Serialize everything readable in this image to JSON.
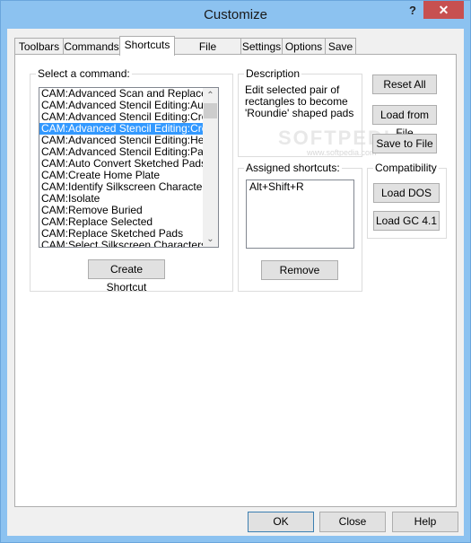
{
  "window": {
    "title": "Customize",
    "help_label": "?",
    "close_label": "✕"
  },
  "tabs": [
    {
      "label": "Toolbars",
      "active": false
    },
    {
      "label": "Commands",
      "active": false
    },
    {
      "label": "Shortcuts",
      "active": true
    },
    {
      "label": "File Locations",
      "active": false
    },
    {
      "label": "Settings",
      "active": false
    },
    {
      "label": "Options",
      "active": false
    },
    {
      "label": "Save",
      "active": false
    }
  ],
  "commands": {
    "legend": "Select a command:",
    "items": [
      "CAM:Advanced Scan and Replace",
      "CAM:Advanced Stencil Editing:Auto F",
      "CAM:Advanced Stencil Editing:Create",
      "CAM:Advanced Stencil Editing:Create",
      "CAM:Advanced Stencil Editing:Heel a",
      "CAM:Advanced Stencil Editing:Pad S",
      "CAM:Auto Convert Sketched Pads",
      "CAM:Create Home Plate",
      "CAM:Identify Silkscreen Characters",
      "CAM:Isolate",
      "CAM:Remove Buried",
      "CAM:Replace Selected",
      "CAM:Replace Sketched Pads",
      "CAM:Select Silkscreen Characters"
    ],
    "selected_index": 3,
    "create_shortcut_label": "Create Shortcut"
  },
  "description": {
    "legend": "Description",
    "text_lines": [
      "Edit selected pair of",
      "rectangles to become",
      "'Roundie' shaped pads"
    ]
  },
  "assigned": {
    "legend": "Assigned shortcuts:",
    "items": [
      "Alt+Shift+R"
    ],
    "remove_label": "Remove"
  },
  "actions": {
    "reset_all": "Reset All",
    "load_from_file": "Load from File",
    "save_to_file": "Save to File"
  },
  "compatibility": {
    "legend": "Compatibility",
    "load_dos": "Load DOS",
    "load_gc": "Load GC 4.1"
  },
  "footer": {
    "ok": "OK",
    "close": "Close",
    "help": "Help"
  },
  "watermark": {
    "brand": "SOFTPEDIA",
    "url": "www.softpedia.com"
  }
}
